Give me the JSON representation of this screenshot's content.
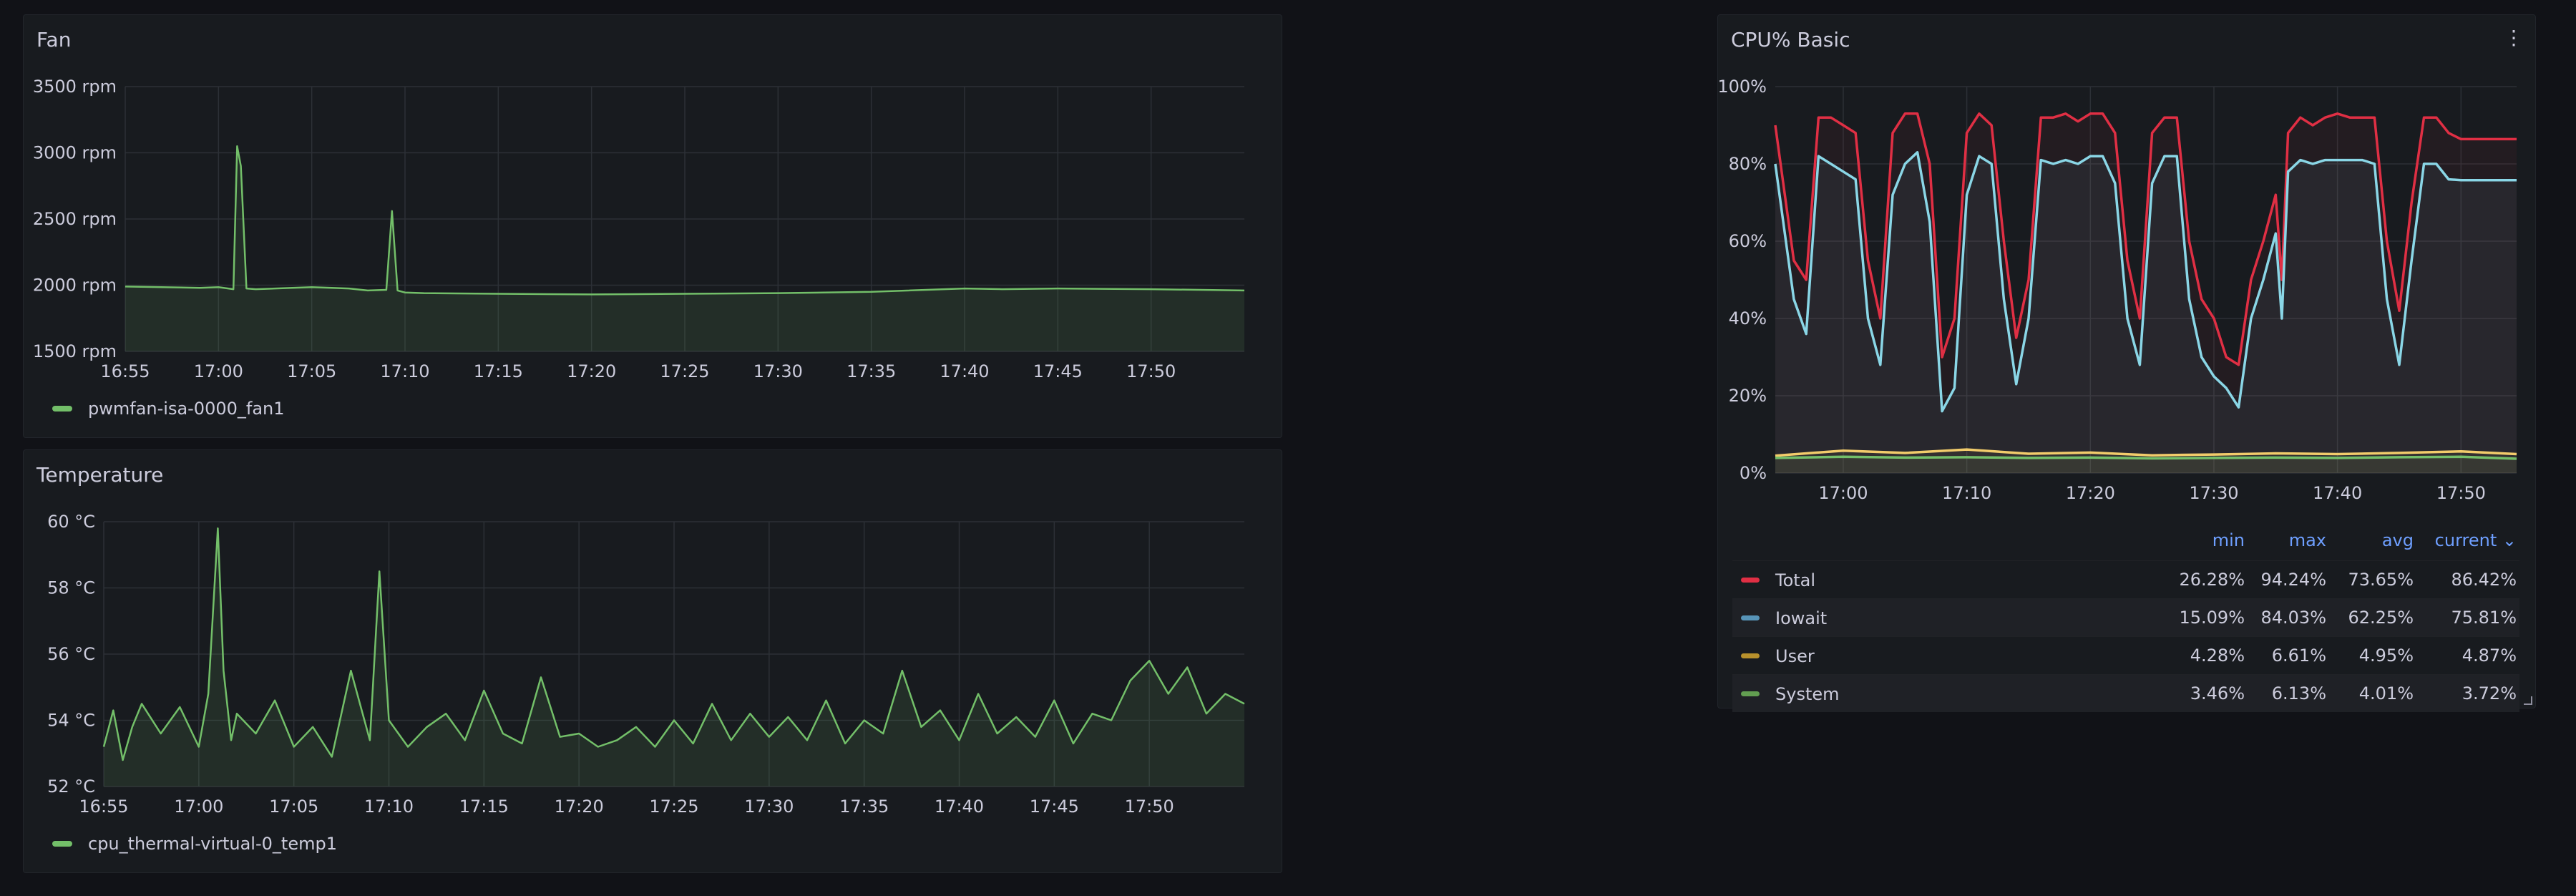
{
  "colors": {
    "green": "#73bf69",
    "red": "#e02f44",
    "blue": "#8ab8ff",
    "lightblue": "#8ad6e6",
    "yellow": "#f2cc6b",
    "accent": "#6e9fff"
  },
  "fan_panel": {
    "title": "Fan",
    "legend": "pwmfan-isa-0000_fan1"
  },
  "temp_panel": {
    "title": "Temperature",
    "legend": "cpu_thermal-virtual-0_temp1"
  },
  "cpu_panel": {
    "title": "CPU% Basic",
    "menu_icon": "vertical-dots-icon",
    "legend_headers": {
      "min": "min",
      "max": "max",
      "avg": "avg",
      "current": "current"
    },
    "legend_rows": [
      {
        "name": "Total",
        "min": "26.28%",
        "max": "94.24%",
        "avg": "73.65%",
        "current": "86.42%"
      },
      {
        "name": "Iowait",
        "min": "15.09%",
        "max": "84.03%",
        "avg": "62.25%",
        "current": "75.81%"
      },
      {
        "name": "User",
        "min": "4.28%",
        "max": "6.61%",
        "avg": "4.95%",
        "current": "4.87%"
      },
      {
        "name": "System",
        "min": "3.46%",
        "max": "6.13%",
        "avg": "4.01%",
        "current": "3.72%"
      }
    ]
  },
  "chart_data": [
    {
      "type": "line",
      "title": "Fan",
      "y_ticks": [
        "1500 rpm",
        "2000 rpm",
        "2500 rpm",
        "3000 rpm",
        "3500 rpm"
      ],
      "ylim": [
        1500,
        3500
      ],
      "x_ticks": [
        "16:55",
        "17:00",
        "17:05",
        "17:10",
        "17:15",
        "17:20",
        "17:25",
        "17:30",
        "17:35",
        "17:40",
        "17:45",
        "17:50"
      ],
      "xlim_minutes": [
        0,
        60
      ],
      "series": [
        {
          "name": "pwmfan-isa-0000_fan1",
          "x": [
            0,
            4,
            5,
            5.8,
            6,
            6.2,
            6.5,
            7,
            10,
            12,
            13,
            14,
            14.3,
            14.6,
            15,
            16,
            20,
            25,
            30,
            35,
            40,
            45,
            47,
            50,
            55,
            60
          ],
          "y": [
            1990,
            1980,
            1985,
            1970,
            3050,
            2900,
            1975,
            1970,
            1985,
            1975,
            1960,
            1965,
            2560,
            1960,
            1945,
            1940,
            1935,
            1930,
            1935,
            1940,
            1950,
            1975,
            1970,
            1975,
            1970,
            1960
          ]
        }
      ],
      "grid": true,
      "legend_position": "bottom-left"
    },
    {
      "type": "line",
      "title": "Temperature",
      "y_ticks": [
        "52 °C",
        "54 °C",
        "56 °C",
        "58 °C",
        "60 °C"
      ],
      "ylim": [
        52,
        60
      ],
      "x_ticks": [
        "16:55",
        "17:00",
        "17:05",
        "17:10",
        "17:15",
        "17:20",
        "17:25",
        "17:30",
        "17:35",
        "17:40",
        "17:45",
        "17:50"
      ],
      "xlim_minutes": [
        0,
        60
      ],
      "series": [
        {
          "name": "cpu_thermal-virtual-0_temp1",
          "x": [
            0,
            0.5,
            1,
            1.5,
            2,
            3,
            4,
            5,
            5.5,
            6,
            6.3,
            6.7,
            7,
            8,
            9,
            10,
            11,
            12,
            13,
            14,
            14.5,
            15,
            15.5,
            16,
            17,
            18,
            19,
            20,
            21,
            22,
            23,
            24,
            25,
            26,
            27,
            28,
            29,
            30,
            31,
            32,
            33,
            34,
            35,
            36,
            37,
            38,
            39,
            40,
            41,
            42,
            43,
            44,
            45,
            46,
            47,
            48,
            49,
            50,
            51,
            52,
            53,
            54,
            55,
            56,
            57,
            58,
            59,
            60
          ],
          "y": [
            53.2,
            54.3,
            52.8,
            53.8,
            54.5,
            53.6,
            54.4,
            53.2,
            54.8,
            59.8,
            55.5,
            53.4,
            54.2,
            53.6,
            54.6,
            53.2,
            53.8,
            52.9,
            55.5,
            53.4,
            58.5,
            54.0,
            53.6,
            53.2,
            53.8,
            54.2,
            53.4,
            54.9,
            53.6,
            53.3,
            55.3,
            53.5,
            53.6,
            53.2,
            53.4,
            53.8,
            53.2,
            54.0,
            53.3,
            54.5,
            53.4,
            54.2,
            53.5,
            54.1,
            53.4,
            54.6,
            53.3,
            54.0,
            53.6,
            55.5,
            53.8,
            54.3,
            53.4,
            54.8,
            53.6,
            54.1,
            53.5,
            54.6,
            53.3,
            54.2,
            54.0,
            55.2,
            55.8,
            54.8,
            55.6,
            54.2,
            54.8,
            54.5
          ]
        }
      ],
      "grid": true,
      "legend_position": "bottom-left"
    },
    {
      "type": "line",
      "title": "CPU% Basic",
      "y_ticks": [
        "0%",
        "20%",
        "40%",
        "60%",
        "80%",
        "100%"
      ],
      "ylim": [
        0,
        100
      ],
      "x_ticks": [
        "17:00",
        "17:10",
        "17:20",
        "17:30",
        "17:40",
        "17:50"
      ],
      "xlim_minutes": [
        -5.5,
        54.5
      ],
      "series": [
        {
          "name": "Total",
          "x": [
            -5.5,
            -4,
            -3,
            -2,
            -1,
            0,
            1,
            2,
            3,
            4,
            5,
            6,
            7,
            8,
            9,
            10,
            11,
            12,
            13,
            14,
            15,
            16,
            17,
            18,
            19,
            20,
            21,
            22,
            23,
            24,
            25,
            26,
            27,
            28,
            29,
            30,
            31,
            32,
            33,
            34,
            35,
            35.5,
            36,
            37,
            38,
            39,
            40,
            41,
            42,
            43,
            44,
            45,
            46,
            47,
            48,
            49,
            50,
            51,
            52,
            53,
            54,
            54.5
          ],
          "y": [
            90,
            55,
            50,
            92,
            92,
            90,
            88,
            55,
            40,
            88,
            93,
            93,
            80,
            30,
            40,
            88,
            93,
            90,
            60,
            35,
            50,
            92,
            92,
            93,
            91,
            93,
            93,
            88,
            55,
            40,
            88,
            92,
            92,
            60,
            45,
            40,
            30,
            28,
            50,
            60,
            72,
            50,
            88,
            92,
            90,
            92,
            93,
            92,
            92,
            92,
            60,
            42,
            70,
            92,
            92,
            88,
            86.4,
            86.4,
            86.4,
            86.4,
            86.4,
            86.4
          ]
        },
        {
          "name": "Iowait",
          "x": [
            -5.5,
            -4,
            -3,
            -2,
            -1,
            0,
            1,
            2,
            3,
            4,
            5,
            6,
            7,
            8,
            9,
            10,
            11,
            12,
            13,
            14,
            15,
            16,
            17,
            18,
            19,
            20,
            21,
            22,
            23,
            24,
            25,
            26,
            27,
            28,
            29,
            30,
            31,
            32,
            33,
            34,
            35,
            35.5,
            36,
            37,
            38,
            39,
            40,
            41,
            42,
            43,
            44,
            45,
            46,
            47,
            48,
            49,
            50,
            51,
            52,
            53,
            54,
            54.5
          ],
          "y": [
            80,
            45,
            36,
            82,
            80,
            78,
            76,
            40,
            28,
            72,
            80,
            83,
            65,
            16,
            22,
            72,
            82,
            80,
            45,
            23,
            40,
            81,
            80,
            81,
            80,
            82,
            82,
            75,
            40,
            28,
            75,
            82,
            82,
            45,
            30,
            25,
            22,
            17,
            40,
            50,
            62,
            40,
            78,
            81,
            80,
            81,
            81,
            81,
            81,
            80,
            45,
            28,
            55,
            80,
            80,
            76,
            75.8,
            75.8,
            75.8,
            75.8,
            75.8,
            75.8
          ]
        },
        {
          "name": "User",
          "x": [
            -5.5,
            0,
            5,
            10,
            15,
            20,
            25,
            30,
            35,
            40,
            45,
            50,
            54.5
          ],
          "y": [
            4.5,
            5.8,
            5.2,
            6.1,
            5.0,
            5.3,
            4.6,
            4.8,
            5.1,
            4.9,
            5.2,
            5.6,
            4.9
          ]
        },
        {
          "name": "System",
          "x": [
            -5.5,
            0,
            5,
            10,
            15,
            20,
            25,
            30,
            35,
            40,
            45,
            50,
            54.5
          ],
          "y": [
            3.9,
            4.2,
            4.0,
            4.1,
            3.9,
            4.0,
            3.8,
            3.9,
            4.0,
            3.9,
            4.1,
            4.2,
            3.7
          ]
        }
      ],
      "grid": true,
      "legend_position": "bottom"
    }
  ]
}
